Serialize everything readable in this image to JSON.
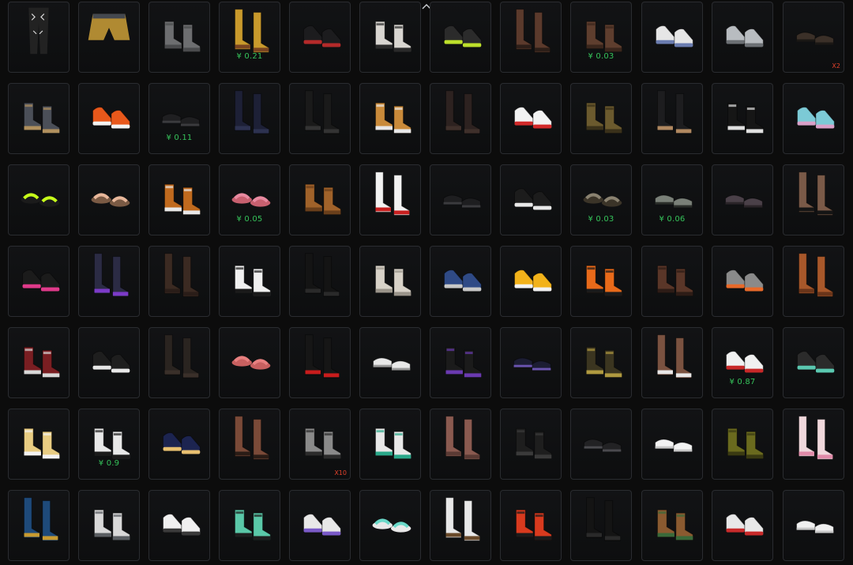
{
  "header": {
    "collapse_icon": "chevron-up-icon"
  },
  "inventory": {
    "rows": [
      [
        {
          "name": "patterned-pants",
          "kind": "pants",
          "colors": [
            "#222222",
            "#dddddd"
          ]
        },
        {
          "name": "denim-shorts-belt",
          "kind": "shorts",
          "colors": [
            "#b08a32",
            "#44484f"
          ]
        },
        {
          "name": "grey-ankle-boots",
          "kind": "boot-short",
          "colors": [
            "#6d6e70",
            "#4a4b4d"
          ]
        },
        {
          "name": "mustard-tall-socks",
          "kind": "boot-tall",
          "colors": [
            "#c99a2c",
            "#7a4421"
          ],
          "price": "¥ 0.21"
        },
        {
          "name": "black-red-sneakers",
          "kind": "sneaker",
          "colors": [
            "#1c1c1e",
            "#b42a2a"
          ]
        },
        {
          "name": "white-combat-boots",
          "kind": "boot-short",
          "colors": [
            "#d8d5d0",
            "#2a2a2a"
          ]
        },
        {
          "name": "lime-black-sneakers",
          "kind": "sneaker",
          "colors": [
            "#2b2b2b",
            "#bde02b"
          ]
        },
        {
          "name": "brown-buckle-boots",
          "kind": "boot-tall",
          "colors": [
            "#5b3a2c",
            "#2c1e18"
          ]
        },
        {
          "name": "brown-leather-boots",
          "kind": "boot-short",
          "colors": [
            "#5e3e2e",
            "#3a261c"
          ],
          "price": "¥ 0.03"
        },
        {
          "name": "white-hi-top",
          "kind": "sneaker",
          "colors": [
            "#e6e6e6",
            "#6b7db0"
          ]
        },
        {
          "name": "camo-hi-top",
          "kind": "sneaker",
          "colors": [
            "#b8bcc0",
            "#6c7074"
          ]
        },
        {
          "name": "dark-slip-on",
          "kind": "shoe",
          "colors": [
            "#3b3028",
            "#1b1815"
          ],
          "qty": "X2"
        }
      ],
      [
        {
          "name": "grey-work-boots",
          "kind": "boot-short",
          "colors": [
            "#4b4f58",
            "#b0905e"
          ]
        },
        {
          "name": "orange-sneakers",
          "kind": "sneaker",
          "colors": [
            "#e8581b",
            "#f2f2f2"
          ]
        },
        {
          "name": "black-loafers",
          "kind": "shoe",
          "colors": [
            "#1f1f21",
            "#3b3b3e"
          ],
          "price": "¥ 0.11"
        },
        {
          "name": "navy-tall-boots",
          "kind": "boot-tall",
          "colors": [
            "#1d2036",
            "#2d3250"
          ]
        },
        {
          "name": "black-knee-boots",
          "kind": "boot-tall",
          "colors": [
            "#1a1a1a",
            "#333333"
          ]
        },
        {
          "name": "tan-shoes-socks",
          "kind": "boot-short",
          "colors": [
            "#c98a3a",
            "#e8e8e8"
          ]
        },
        {
          "name": "dark-tall-boots",
          "kind": "boot-tall",
          "colors": [
            "#2d2220",
            "#3f302b"
          ]
        },
        {
          "name": "white-red-sneakers",
          "kind": "sneaker",
          "colors": [
            "#f2f2f2",
            "#d22a2a"
          ]
        },
        {
          "name": "olive-combat-boots",
          "kind": "boot-short",
          "colors": [
            "#6b5a2e",
            "#3a311a"
          ]
        },
        {
          "name": "black-gaiter-sandals",
          "kind": "boot-tall",
          "colors": [
            "#1d1d1f",
            "#b08860"
          ]
        },
        {
          "name": "black-white-boots",
          "kind": "boot-short",
          "colors": [
            "#161616",
            "#e0e0e0"
          ]
        },
        {
          "name": "pastel-hi-top",
          "kind": "sneaker",
          "colors": [
            "#7ccad6",
            "#d9a0c8"
          ]
        }
      ],
      [
        {
          "name": "neon-swim-fins",
          "kind": "sandal",
          "colors": [
            "#c7ff1a",
            "#1b1b1b"
          ]
        },
        {
          "name": "tan-slides",
          "kind": "sandal",
          "colors": [
            "#e8b79a",
            "#7a5a44"
          ]
        },
        {
          "name": "tiger-sandals",
          "kind": "boot-short",
          "colors": [
            "#c06a1e",
            "#e8e8e8"
          ]
        },
        {
          "name": "pink-slides",
          "kind": "sandal",
          "colors": [
            "#e88aa0",
            "#c7606f"
          ],
          "price": "¥ 0.05"
        },
        {
          "name": "brown-slouch-boots",
          "kind": "boot-short",
          "colors": [
            "#a0622a",
            "#6a3f1b"
          ]
        },
        {
          "name": "white-leg-warmers",
          "kind": "boot-tall",
          "colors": [
            "#f2f2f2",
            "#c82020"
          ]
        },
        {
          "name": "black-dress-shoes",
          "kind": "shoe",
          "colors": [
            "#1e1e20",
            "#3b3b3e"
          ]
        },
        {
          "name": "black-hi-tops",
          "kind": "sneaker",
          "colors": [
            "#1c1c1c",
            "#e8e8e8"
          ]
        },
        {
          "name": "olive-flip-flops",
          "kind": "sandal",
          "colors": [
            "#8a8270",
            "#3b3428"
          ],
          "price": "¥ 0.03"
        },
        {
          "name": "grey-slip-ons",
          "kind": "shoe",
          "colors": [
            "#7a8078",
            "#2b2e2a"
          ],
          "price": "¥ 0.06"
        },
        {
          "name": "plum-slip-ons",
          "kind": "shoe",
          "colors": [
            "#4a4048",
            "#2a2428"
          ]
        },
        {
          "name": "bare-legs-boots",
          "kind": "boot-tall",
          "colors": [
            "#7a5a48",
            "#151515"
          ]
        }
      ],
      [
        {
          "name": "pink-lace-sneakers",
          "kind": "sneaker",
          "colors": [
            "#1b1b1b",
            "#e03a8a"
          ]
        },
        {
          "name": "purple-strap-sneakers",
          "kind": "boot-tall",
          "colors": [
            "#2b2b44",
            "#7c3ac8"
          ]
        },
        {
          "name": "brown-thigh-boots",
          "kind": "boot-tall",
          "colors": [
            "#3b2a22",
            "#2a1d18"
          ]
        },
        {
          "name": "white-cleats",
          "kind": "boot-short",
          "colors": [
            "#f0f0f0",
            "#1a1a1a"
          ]
        },
        {
          "name": "black-stockings",
          "kind": "boot-tall",
          "colors": [
            "#141414",
            "#2a2a2a"
          ]
        },
        {
          "name": "cream-boots",
          "kind": "boot-short",
          "colors": [
            "#d8d2c8",
            "#9a948a"
          ]
        },
        {
          "name": "blue-sneakers",
          "kind": "sneaker",
          "colors": [
            "#2f4a86",
            "#c8c8c8"
          ]
        },
        {
          "name": "yellow-white-sneakers",
          "kind": "sneaker",
          "colors": [
            "#f2b21a",
            "#f2f2f2"
          ]
        },
        {
          "name": "flame-boots",
          "kind": "boot-short",
          "colors": [
            "#e86a1a",
            "#1b1b1b"
          ]
        },
        {
          "name": "brown-lace-boots",
          "kind": "boot-short",
          "colors": [
            "#5a3628",
            "#2d1c16"
          ]
        },
        {
          "name": "grey-orange-sneakers",
          "kind": "sneaker",
          "colors": [
            "#8a8a8a",
            "#e86a2a"
          ]
        },
        {
          "name": "cognac-tall-boots",
          "kind": "boot-tall",
          "colors": [
            "#a8582a",
            "#6a351a"
          ]
        }
      ],
      [
        {
          "name": "maroon-combat-boots",
          "kind": "boot-short",
          "colors": [
            "#7a1e22",
            "#d8d8d8"
          ]
        },
        {
          "name": "black-lace-sneakers",
          "kind": "sneaker",
          "colors": [
            "#1e1e1e",
            "#e8e8e8"
          ]
        },
        {
          "name": "dark-tall-socks",
          "kind": "boot-tall",
          "colors": [
            "#2a2420",
            "#3a302a"
          ]
        },
        {
          "name": "pink-fluffy-slippers",
          "kind": "sandal",
          "colors": [
            "#e88080",
            "#c86060"
          ]
        },
        {
          "name": "red-stripe-socks",
          "kind": "boot-tall",
          "colors": [
            "#161616",
            "#c81c1c"
          ]
        },
        {
          "name": "white-loafers",
          "kind": "shoe",
          "colors": [
            "#e8e8e8",
            "#9a9a9a"
          ]
        },
        {
          "name": "purple-black-boots",
          "kind": "boot-short",
          "colors": [
            "#1b1b1b",
            "#6a3ab0"
          ]
        },
        {
          "name": "navy-purple-shoes",
          "kind": "shoe",
          "colors": [
            "#1c1d33",
            "#6a54b0"
          ]
        },
        {
          "name": "gold-combat-boots",
          "kind": "boot-short",
          "colors": [
            "#3b3520",
            "#b09a40"
          ]
        },
        {
          "name": "brown-lace-gaiters",
          "kind": "boot-tall",
          "colors": [
            "#7a5240",
            "#e8e8e8"
          ]
        },
        {
          "name": "white-red-sole-sneakers",
          "kind": "sneaker",
          "colors": [
            "#f0f0f0",
            "#c82828"
          ],
          "price": "¥ 0.87"
        },
        {
          "name": "teal-trim-sneakers",
          "kind": "sneaker",
          "colors": [
            "#2b2b2b",
            "#5ac8b0"
          ]
        }
      ],
      [
        {
          "name": "cream-gold-boots",
          "kind": "boot-short",
          "colors": [
            "#e8cc82",
            "#f2f2f2"
          ]
        },
        {
          "name": "white-strap-boots",
          "kind": "boot-short",
          "colors": [
            "#e8e8e8",
            "#1b1b1b"
          ],
          "price": "¥ 0.9"
        },
        {
          "name": "navy-gold-sneakers",
          "kind": "sneaker",
          "colors": [
            "#1c2450",
            "#e8c070"
          ]
        },
        {
          "name": "brown-lace-legs",
          "kind": "boot-tall",
          "colors": [
            "#7a4a38",
            "#2a1c16"
          ]
        },
        {
          "name": "grey-ankle-boots-b",
          "kind": "boot-short",
          "colors": [
            "#8a8a8a",
            "#2b2b2b"
          ],
          "qty": "X10"
        },
        {
          "name": "teal-white-hi-tops",
          "kind": "boot-short",
          "colors": [
            "#e8e8e8",
            "#2aa88a"
          ]
        },
        {
          "name": "mauve-thigh-socks",
          "kind": "boot-tall",
          "colors": [
            "#8a5a50",
            "#5a3a34"
          ]
        },
        {
          "name": "black-buckle-boots",
          "kind": "boot-short",
          "colors": [
            "#1e1e1e",
            "#3a3a3a"
          ]
        },
        {
          "name": "black-sneakers",
          "kind": "shoe",
          "colors": [
            "#222224",
            "#4a4a4e"
          ]
        },
        {
          "name": "white-flats",
          "kind": "shoe",
          "colors": [
            "#f2f2f2",
            "#c8c8c8"
          ]
        },
        {
          "name": "olive-rain-boots",
          "kind": "boot-short",
          "colors": [
            "#6a6a1e",
            "#3a3a12"
          ]
        },
        {
          "name": "pink-sport-socks",
          "kind": "boot-tall",
          "colors": [
            "#f0d8dc",
            "#e08aa8"
          ]
        }
      ],
      [
        {
          "name": "blue-camo-boots",
          "kind": "boot-tall",
          "colors": [
            "#1e4a7a",
            "#c89a30"
          ]
        },
        {
          "name": "white-snow-boots",
          "kind": "boot-short",
          "colors": [
            "#d8d8d8",
            "#5a5e62"
          ]
        },
        {
          "name": "white-sneakers",
          "kind": "sneaker",
          "colors": [
            "#f0f0f0",
            "#3a3a3a"
          ]
        },
        {
          "name": "mint-combat-boots",
          "kind": "boot-short",
          "colors": [
            "#5ac8a8",
            "#1e1e1e"
          ]
        },
        {
          "name": "white-purple-sneakers",
          "kind": "sneaker",
          "colors": [
            "#e8e8e8",
            "#7a5ac8"
          ]
        },
        {
          "name": "mint-sandals",
          "kind": "sandal",
          "colors": [
            "#6ad8c8",
            "#e8e8e8"
          ]
        },
        {
          "name": "white-sock-loafers",
          "kind": "boot-tall",
          "colors": [
            "#e8e8e8",
            "#6a4a2a"
          ]
        },
        {
          "name": "red-ski-boots",
          "kind": "boot-short",
          "colors": [
            "#d83a1e",
            "#1b1b1b"
          ]
        },
        {
          "name": "black-thigh-boots",
          "kind": "boot-tall",
          "colors": [
            "#141414",
            "#2a2a2a"
          ]
        },
        {
          "name": "brown-green-boots",
          "kind": "boot-short",
          "colors": [
            "#8a5a30",
            "#3a6a3a"
          ]
        },
        {
          "name": "red-white-hi-tops",
          "kind": "sneaker",
          "colors": [
            "#e8e8e8",
            "#c82a2a"
          ]
        },
        {
          "name": "white-low-sneakers",
          "kind": "shoe",
          "colors": [
            "#f0f0f0",
            "#c8c8c8"
          ]
        }
      ]
    ]
  }
}
